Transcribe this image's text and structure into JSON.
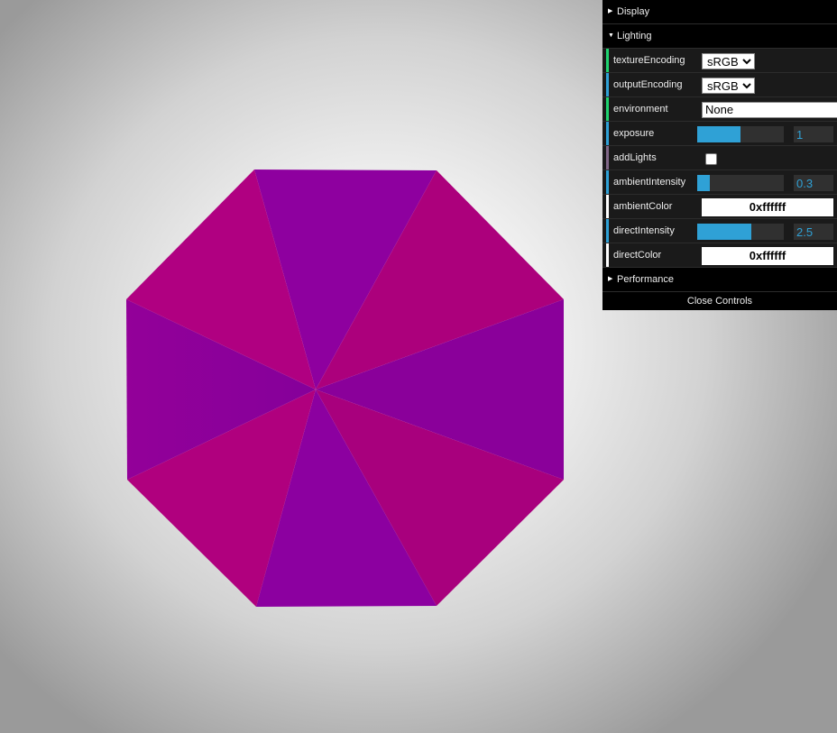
{
  "gui": {
    "folders": {
      "display": {
        "title": "Display",
        "arrow": "▶"
      },
      "lighting": {
        "title": "Lighting",
        "arrow": "▼"
      },
      "performance": {
        "title": "Performance",
        "arrow": "▶"
      }
    },
    "lighting": {
      "textureEncoding": {
        "label": "textureEncoding",
        "value": "sRGB"
      },
      "outputEncoding": {
        "label": "outputEncoding",
        "value": "sRGB"
      },
      "environment": {
        "label": "environment",
        "value": "None"
      },
      "exposure": {
        "label": "exposure",
        "value": "1",
        "fraction": 0.5
      },
      "addLights": {
        "label": "addLights",
        "checked": false
      },
      "ambientIntensity": {
        "label": "ambientIntensity",
        "value": "0.3",
        "fraction": 0.15
      },
      "ambientColor": {
        "label": "ambientColor",
        "value": "0xffffff"
      },
      "directIntensity": {
        "label": "directIntensity",
        "value": "2.5",
        "fraction": 0.625
      },
      "directColor": {
        "label": "directColor",
        "value": "0xffffff"
      }
    },
    "close_label": "Close Controls"
  },
  "colors": {
    "accent": "#2fa1d6",
    "number_controller": "#2fa1d6",
    "option_controller": "#1ed36f",
    "boolean_controller": "#806787",
    "color_controller": "#ffffff",
    "model_magenta": "#b0007e",
    "model_purple": "#8c009e"
  }
}
